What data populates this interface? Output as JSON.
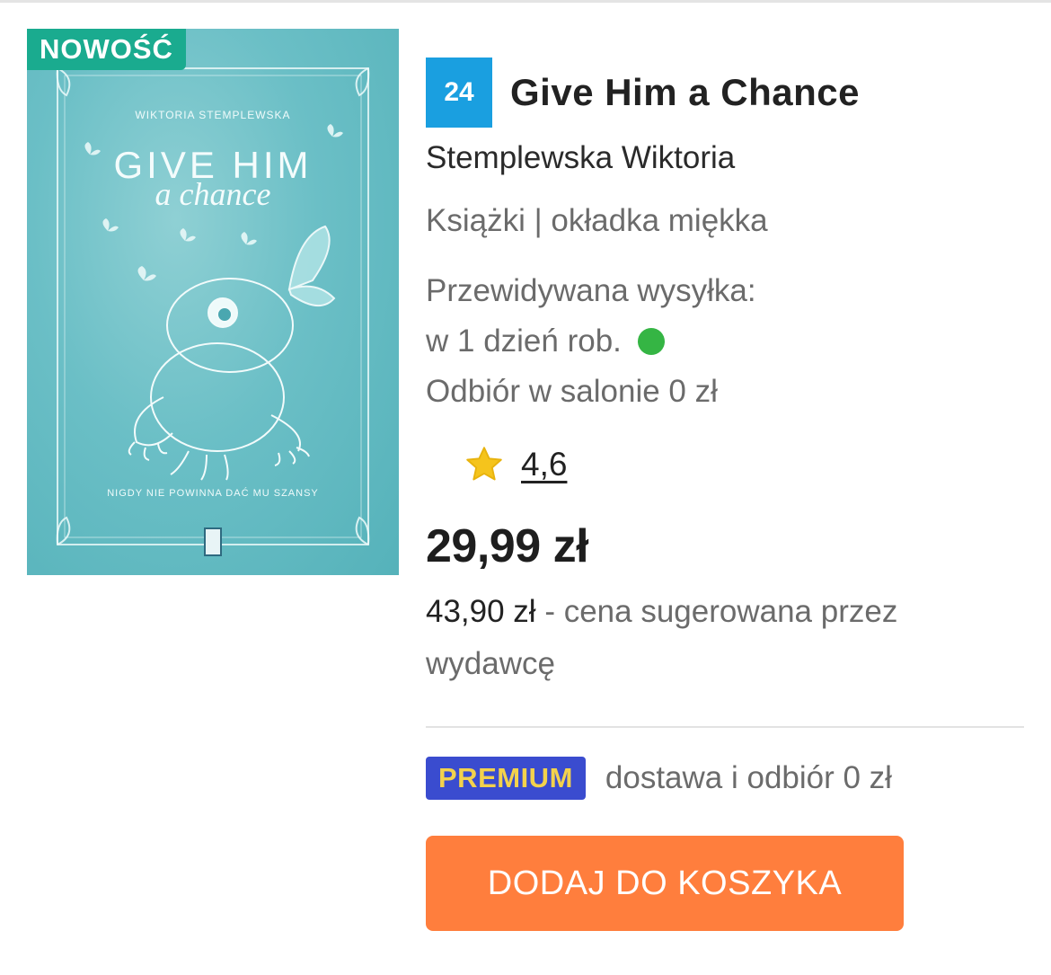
{
  "product": {
    "badge_new": "NOWOŚĆ",
    "cover": {
      "author_text": "WIKTORIA STEMPLEWSKA",
      "title_line1": "GIVE HIM",
      "title_line2": "a chance",
      "tagline": "NIGDY NIE POWINNA DAĆ MU SZANSY"
    },
    "rank": "24",
    "title": "Give Him a Chance",
    "author": "Stemplewska Wiktoria",
    "format": "Książki | okładka  miękka",
    "shipping": {
      "label": "Przewidywana wysyłka:",
      "time": "w 1 dzień rob.",
      "status_color": "#35b544",
      "pickup": "Odbiór w salonie 0 zł"
    },
    "rating": {
      "icon": "star-icon",
      "value": "4,6"
    },
    "price": "29,99 zł",
    "suggested_price": {
      "amount": "43,90 zł",
      "text": " - cena sugerowana przez wydawcę"
    },
    "premium": {
      "badge": "PREMIUM",
      "text": "dostawa i odbiór 0 zł"
    },
    "cart_button": "DODAJ DO KOSZYKA"
  },
  "colors": {
    "accent_orange": "#ff7e3d",
    "badge_teal": "#1aab8f",
    "rank_blue": "#1a9fe0",
    "premium_blue": "#3a4ccf",
    "premium_gold": "#f3d24c"
  }
}
